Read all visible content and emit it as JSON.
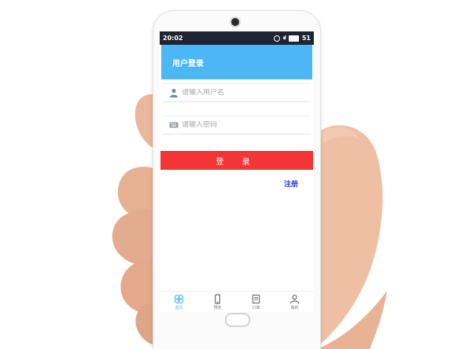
{
  "status_bar": {
    "time": "20:02",
    "signal": "ııl",
    "battery": "51"
  },
  "header": {
    "title": "用户登录"
  },
  "form": {
    "username_placeholder": "请输入用户名",
    "password_placeholder": "请输入密码",
    "login_label": "登 录",
    "register_label": "注册"
  },
  "tabbar": {
    "items": [
      {
        "label": "首页",
        "icon": "clover-icon",
        "active": true
      },
      {
        "label": "预定",
        "icon": "phone-icon",
        "active": false
      },
      {
        "label": "订单",
        "icon": "order-icon",
        "active": false
      },
      {
        "label": "我的",
        "icon": "person-icon",
        "active": false
      }
    ]
  },
  "colors": {
    "header_bg": "#4db6f5",
    "login_button": "#f43535",
    "register_link": "#2a3bd9",
    "status_bar_bg": "#1e2433"
  }
}
